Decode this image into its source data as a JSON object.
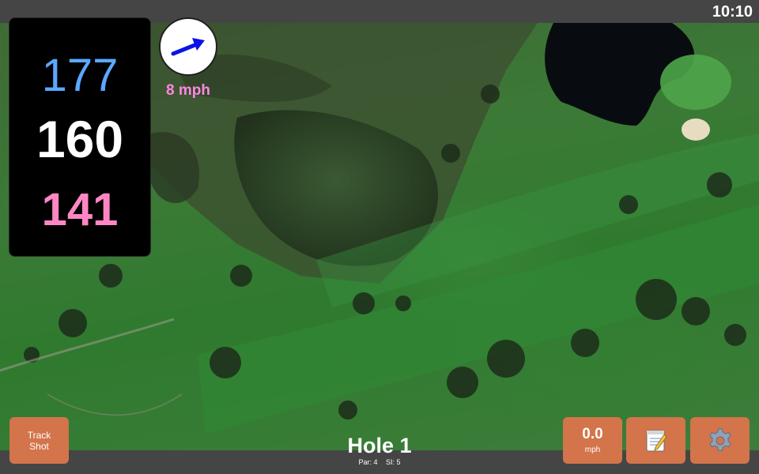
{
  "status_bar": {
    "time": "10:10"
  },
  "distances": {
    "back": "177",
    "middle": "160",
    "front": "141",
    "colors": {
      "back": "#5aa9ff",
      "middle": "#ffffff",
      "front": "#ff86c4"
    }
  },
  "wind": {
    "speed_label": "8 mph",
    "direction_icon": "wind-arrow-icon",
    "arrow_color": "#0a14e6"
  },
  "hole": {
    "title": "Hole 1",
    "par": "Par: 4",
    "stroke_index": "SI: 5"
  },
  "buttons": {
    "track_shot_line1": "Track",
    "track_shot_line2": "Shot",
    "speed_value": "0.0",
    "speed_unit": "mph",
    "note_icon": "note-icon",
    "settings_icon": "gear-icon",
    "accent": "#d4744b"
  }
}
